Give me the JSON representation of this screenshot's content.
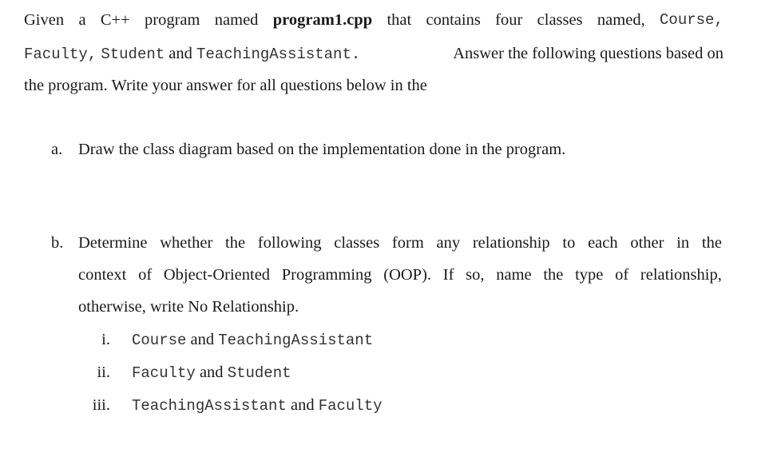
{
  "intro": {
    "line1": {
      "w1": "Given",
      "w2": "a",
      "w3": "C++",
      "w4": "program",
      "w5": "named",
      "filename": "program1.cpp",
      "w6": "that",
      "w7": "contains",
      "w8": "four",
      "w9": "classes",
      "w10": "named,",
      "class1": "Course,"
    },
    "line2": {
      "class2": "Faculty,",
      "class3": "Student",
      "and": "and",
      "class4": "TeachingAssistant.",
      "rest": "Answer the following questions based on"
    },
    "line3": "the program.  Write your answer for all questions below in the"
  },
  "question_a": {
    "label": "a.",
    "text": "Draw the class diagram based on the implementation done in the program."
  },
  "question_b": {
    "label": "b.",
    "line1_words": [
      "Determine",
      "whether",
      "the",
      "following",
      "classes",
      "form",
      "any",
      "relationship",
      "to",
      "each",
      "other",
      "in",
      "the"
    ],
    "line2_words": [
      "context",
      "of",
      "Object-Oriented",
      "Programming",
      "(OOP).",
      "If",
      "so,",
      "name",
      "the",
      "type",
      "of",
      "relationship,"
    ],
    "line3": "otherwise, write No Relationship.",
    "items": [
      {
        "numeral": "i.",
        "class_a": "Course",
        "conj": "and",
        "class_b": "TeachingAssistant"
      },
      {
        "numeral": "ii.",
        "class_a": "Faculty",
        "conj": "and",
        "class_b": "Student"
      },
      {
        "numeral": "iii.",
        "class_a": "TeachingAssistant",
        "conj": "and",
        "class_b": "Faculty"
      }
    ]
  }
}
